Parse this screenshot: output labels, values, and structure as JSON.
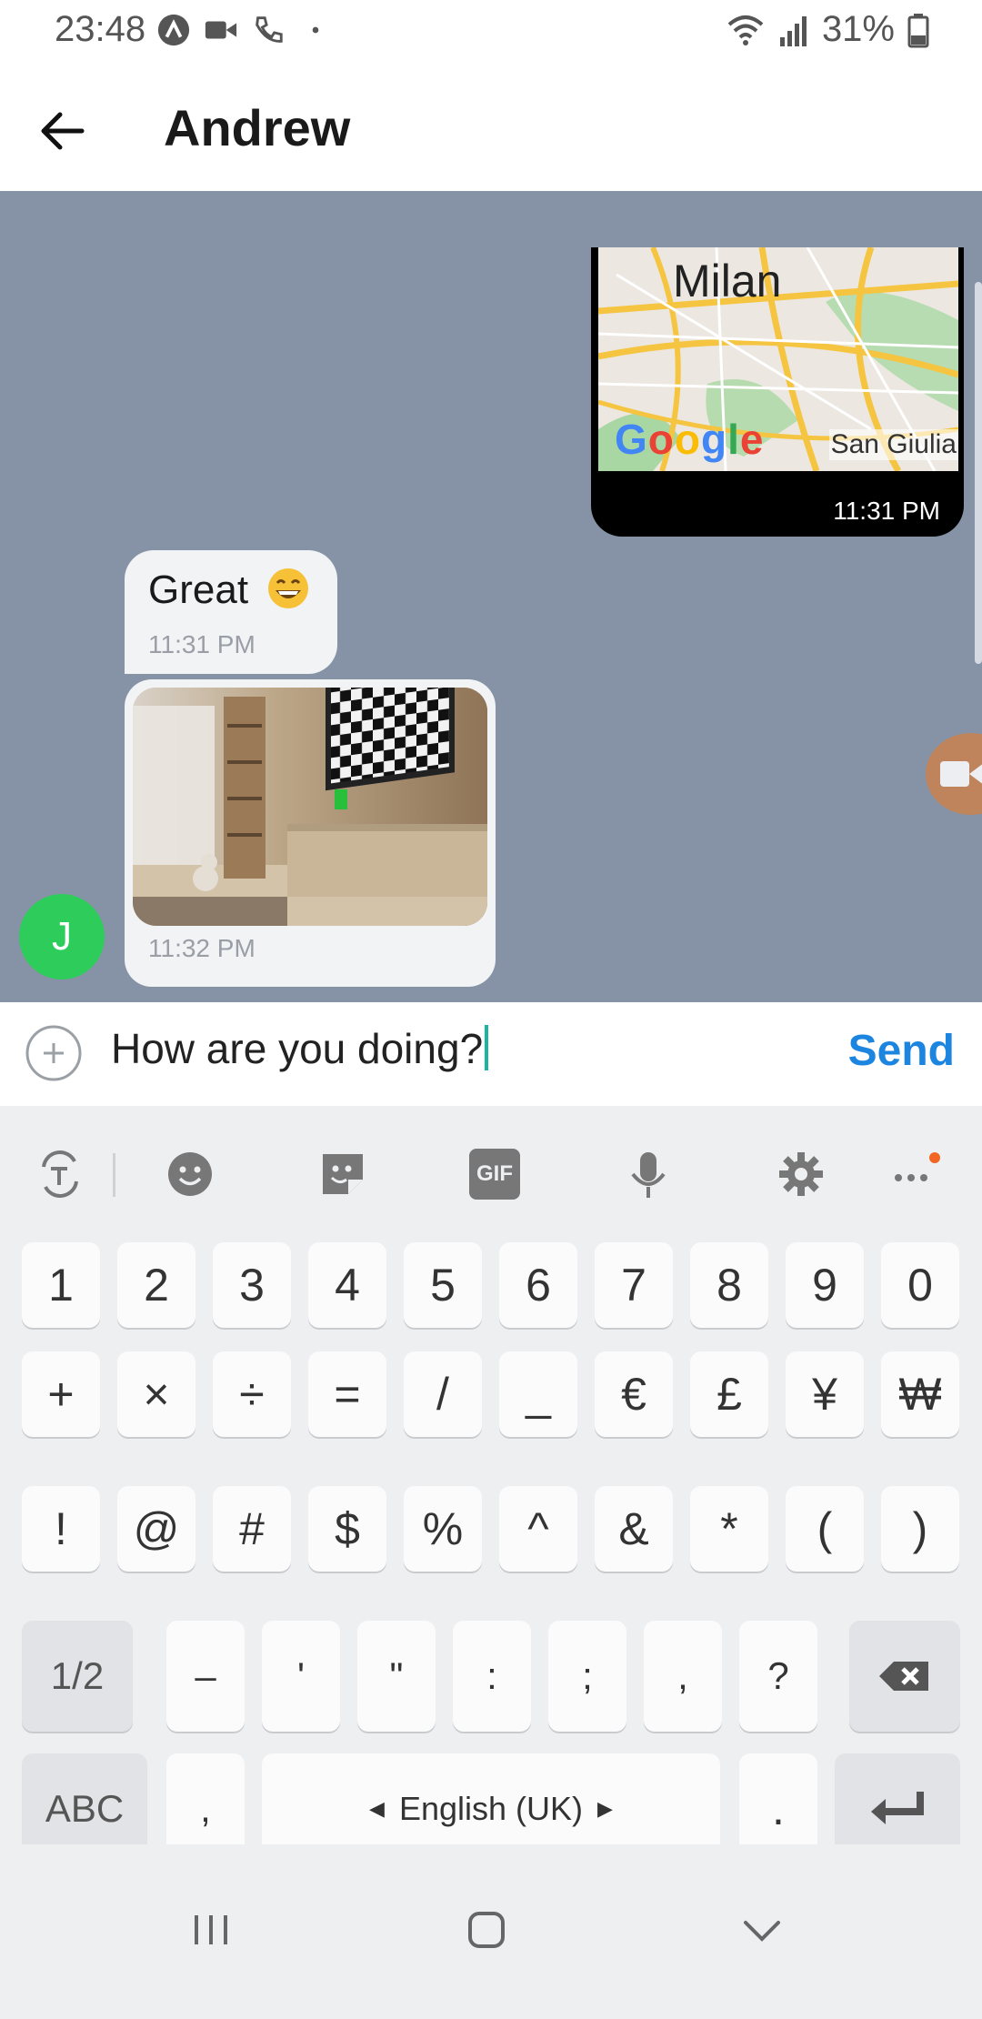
{
  "status_bar": {
    "time": "23:48",
    "battery_percent": "31%",
    "icons": [
      "tinder-icon",
      "video-camera-icon",
      "phone-icon",
      "dot-icon"
    ],
    "right_icons": [
      "wifi-icon",
      "signal-icon",
      "battery-icon"
    ]
  },
  "header": {
    "back_icon": "arrow-left-icon",
    "contact_name": "Andrew"
  },
  "messages": [
    {
      "type": "location",
      "direction": "sent",
      "map_city_label": "Milan",
      "map_corner_label": "San Giulia",
      "map_logo": "Google",
      "time": "11:31 PM"
    },
    {
      "type": "text",
      "direction": "received",
      "text": "Great",
      "emoji": "grinning-face-icon",
      "time": "11:31 PM"
    },
    {
      "type": "image",
      "direction": "received",
      "image_description": "living-room-tv-image",
      "time": "11:32 PM"
    }
  ],
  "avatar": {
    "initial": "J",
    "color": "#2ecc5b"
  },
  "composer": {
    "value": "How are you doing?",
    "send_label": "Send",
    "plus_icon": "add-circle-icon"
  },
  "keyboard": {
    "toolbar": [
      "text-translate-icon",
      "emoji-icon",
      "sticker-icon",
      "gif-icon",
      "mic-icon",
      "settings-icon",
      "more-icon"
    ],
    "gif_label": "GIF",
    "row1": [
      "1",
      "2",
      "3",
      "4",
      "5",
      "6",
      "7",
      "8",
      "9",
      "0"
    ],
    "row2": [
      "+",
      "×",
      "÷",
      "=",
      "/",
      "_",
      "€",
      "£",
      "¥",
      "₩"
    ],
    "row3": [
      "!",
      "@",
      "#",
      "$",
      "%",
      "^",
      "&",
      "*",
      "(",
      ")"
    ],
    "row4": [
      "1/2",
      "–",
      "'",
      "\"",
      ":",
      ";",
      ",",
      "?"
    ],
    "row5_abc": "ABC",
    "row5_comma": ",",
    "row5_space": "English (UK)",
    "row5_period": "."
  },
  "colors": {
    "chat_background": "#8693a6",
    "send": "#1b85e0",
    "avatar": "#2ecc5b"
  }
}
